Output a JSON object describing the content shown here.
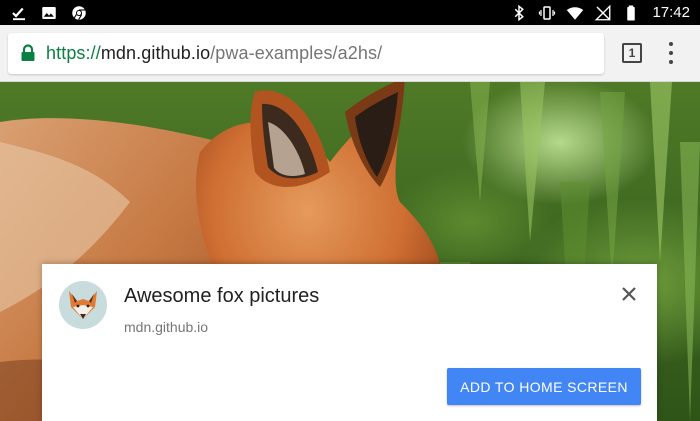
{
  "status_bar": {
    "left_icons": [
      "download-done-icon",
      "image-icon",
      "chrome-icon"
    ],
    "right_icons": [
      "bluetooth-icon",
      "vibrate-icon",
      "wifi-icon",
      "no-signal-icon",
      "battery-icon"
    ],
    "time": "17:42"
  },
  "browser": {
    "url": {
      "scheme": "https://",
      "host": "mdn.github.io",
      "path": "/pwa-examples/a2hs/"
    },
    "tab_count": "1",
    "secure_color": "#0b8043"
  },
  "banner": {
    "title": "Awesome fox pictures",
    "origin": "mdn.github.io",
    "add_button_label": "ADD TO HOME SCREEN",
    "accent_color": "#4285f4",
    "icon": "fox-icon"
  }
}
